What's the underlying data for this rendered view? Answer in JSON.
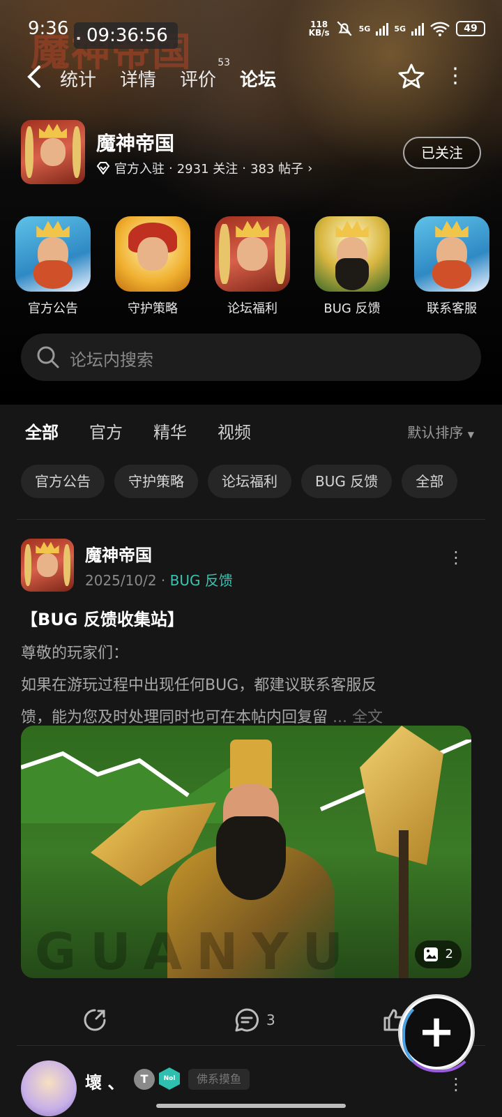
{
  "status_bar": {
    "time": "9:36",
    "clock": "09:36:56",
    "net_speed_value": "118",
    "net_speed_unit": "KB/s",
    "signal_1": "5G",
    "signal_2": "5G",
    "battery": "49"
  },
  "nav": {
    "tabs": [
      {
        "label": "统计"
      },
      {
        "label": "详情"
      },
      {
        "label": "评价",
        "badge": "53"
      },
      {
        "label": "论坛",
        "active": true
      }
    ]
  },
  "banner": {
    "game_logo": "魔神帝国"
  },
  "forum": {
    "name": "魔神帝国",
    "verified_label": "官方入驻",
    "followers": "2931 关注",
    "posts": "383 帖子",
    "follow_button": "已关注"
  },
  "shortcuts": [
    {
      "label": "官方公告",
      "art": "blue"
    },
    {
      "label": "守护策略",
      "art": "gold"
    },
    {
      "label": "论坛福利",
      "art": "red"
    },
    {
      "label": "BUG 反馈",
      "art": "green"
    },
    {
      "label": "联系客服",
      "art": "blue"
    }
  ],
  "search": {
    "placeholder": "论坛内搜索"
  },
  "filter_tabs": [
    {
      "label": "全部",
      "active": true
    },
    {
      "label": "官方"
    },
    {
      "label": "精华"
    },
    {
      "label": "视频"
    }
  ],
  "sort_label": "默认排序",
  "chips": [
    "官方公告",
    "守护策略",
    "论坛福利",
    "BUG 反馈",
    "全部"
  ],
  "post": {
    "author": "魔神帝国",
    "date": "2025/10/2",
    "separator": "·",
    "category": "BUG 反馈",
    "title": "【BUG 反馈收集站】",
    "body_line1": "尊敬的玩家们：",
    "body_line2": " 如果在游玩过程中出现任何BUG，都建议联系客服反",
    "body_line3": "馈，能为您及时处理同时也可在本帖内回复留",
    "more_link": "... 全文",
    "image_watermark": "GUANYU",
    "image_count": "2",
    "comments": "3"
  },
  "next_post": {
    "author": "壞 、",
    "badge1": "T",
    "badge2": "Nol",
    "tag": "佛系摸鱼"
  },
  "colors": {
    "accent": "#2fbfae",
    "background": "#161616",
    "chip_bg": "#262626"
  }
}
